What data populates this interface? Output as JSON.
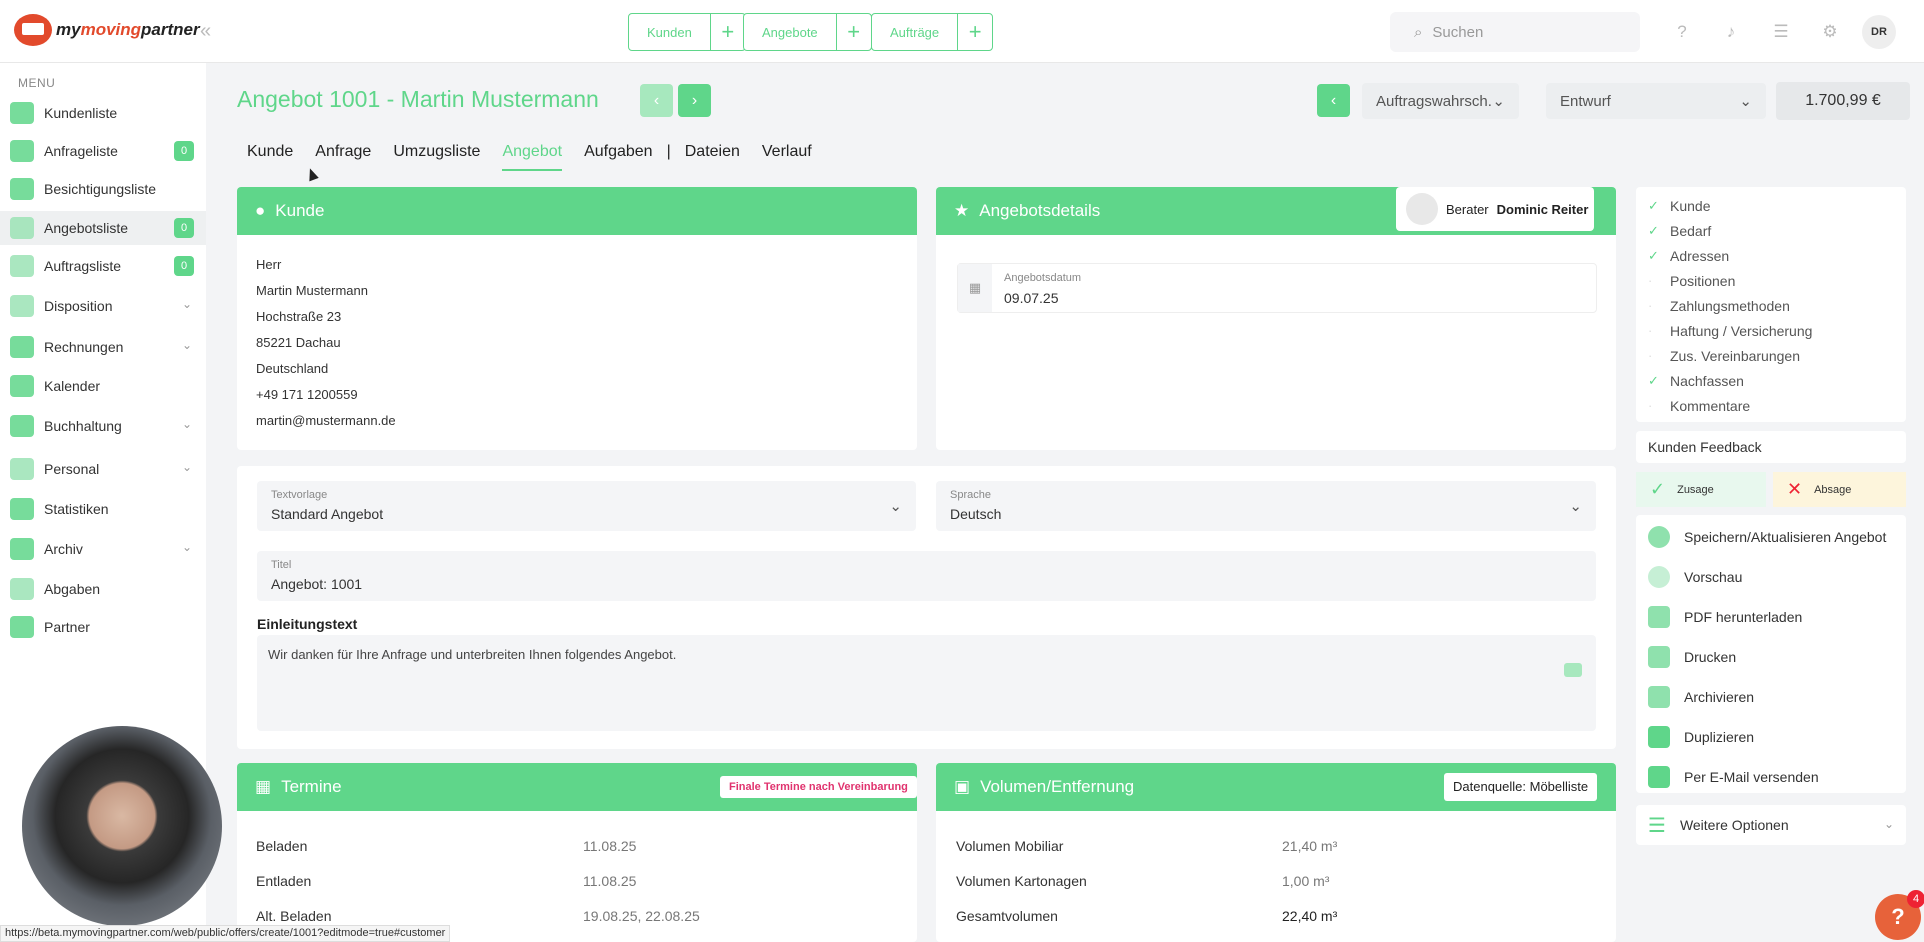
{
  "app": {
    "logo_part1": "my",
    "logo_part2": "moving",
    "logo_part3": "partner"
  },
  "topbar": {
    "quick": [
      {
        "label": "Kunden"
      },
      {
        "label": "Angebote"
      },
      {
        "label": "Aufträge"
      }
    ],
    "search_placeholder": "Suchen",
    "user_initials": "DR"
  },
  "sidebar": {
    "menu_label": "MENU",
    "items": [
      {
        "label": "Kundenliste"
      },
      {
        "label": "Anfrageliste",
        "badge": "0"
      },
      {
        "label": "Besichtigungsliste"
      },
      {
        "label": "Angebotsliste",
        "badge": "0"
      },
      {
        "label": "Auftragsliste",
        "badge": "0"
      },
      {
        "label": "Disposition"
      },
      {
        "label": "Rechnungen"
      },
      {
        "label": "Kalender"
      },
      {
        "label": "Buchhaltung"
      },
      {
        "label": "Personal"
      },
      {
        "label": "Statistiken"
      },
      {
        "label": "Archiv"
      },
      {
        "label": "Abgaben"
      },
      {
        "label": "Partner"
      }
    ]
  },
  "header": {
    "title": "Angebot 1001 - Martin Mustermann",
    "probability_select": "Auftragswahrsch.",
    "status_select": "Entwurf",
    "price": "1.700,99 €"
  },
  "tabs": [
    "Kunde",
    "Anfrage",
    "Umzugsliste",
    "Angebot",
    "Aufgaben",
    "|",
    "Dateien",
    "Verlauf"
  ],
  "customer": {
    "heading": "Kunde",
    "salutation": "Herr",
    "name": "Martin Mustermann",
    "street": "Hochstraße 23",
    "city": "85221 Dachau",
    "country": "Deutschland",
    "phone": "+49 171 1200559",
    "email": "martin@mustermann.de"
  },
  "offer_details": {
    "heading": "Angebotsdetails",
    "advisor_label": "Berater",
    "advisor_name": "Dominic Reiter",
    "date_label": "Angebotsdatum",
    "date_value": "09.07.25"
  },
  "form": {
    "template_label": "Textvorlage",
    "template_value": "Standard Angebot",
    "language_label": "Sprache",
    "language_value": "Deutsch",
    "title_label": "Titel",
    "title_value": "Angebot: 1001",
    "intro_label": "Einleitungstext",
    "intro_text": "Wir danken für Ihre Anfrage und unterbreiten Ihnen folgendes Angebot."
  },
  "appointments": {
    "heading": "Termine",
    "badge": "Finale Termine nach Vereinbarung",
    "rows": [
      {
        "label": "Beladen",
        "value": "11.08.25"
      },
      {
        "label": "Entladen",
        "value": "11.08.25"
      },
      {
        "label": "Alt. Beladen",
        "value": "19.08.25, 22.08.25"
      }
    ]
  },
  "volume": {
    "heading": "Volumen/Entfernung",
    "source_button": "Datenquelle: Möbelliste",
    "rows": [
      {
        "label": "Volumen Mobiliar",
        "value": "21,40 m³"
      },
      {
        "label": "Volumen Kartonagen",
        "value": "1,00 m³"
      },
      {
        "label": "Gesamtvolumen",
        "value": "22,40 m³"
      }
    ]
  },
  "checklist": [
    {
      "label": "Kunde",
      "done": true
    },
    {
      "label": "Bedarf",
      "done": true
    },
    {
      "label": "Adressen",
      "done": true
    },
    {
      "label": "Positionen",
      "done": false
    },
    {
      "label": "Zahlungsmethoden",
      "done": false
    },
    {
      "label": "Haftung / Versicherung",
      "done": false
    },
    {
      "label": "Zus. Vereinbarungen",
      "done": false
    },
    {
      "label": "Nachfassen",
      "done": true
    },
    {
      "label": "Kommentare",
      "done": false
    }
  ],
  "feedback": {
    "heading": "Kunden Feedback",
    "accept": "Zusage",
    "reject": "Absage"
  },
  "actions": [
    {
      "label": "Speichern/Aktualisieren Angebot"
    },
    {
      "label": "Vorschau"
    },
    {
      "label": "PDF herunterladen"
    },
    {
      "label": "Drucken"
    },
    {
      "label": "Archivieren"
    },
    {
      "label": "Duplizieren"
    },
    {
      "label": "Per E-Mail versenden"
    }
  ],
  "more_options": "Weitere Optionen",
  "help": {
    "label": "?",
    "count": "4"
  },
  "status_url": "https://beta.mymovingpartner.com/web/public/offers/create/1001?editmode=true#customer",
  "colors": {
    "accent": "#5fd68a",
    "brand": "#e24a2c"
  }
}
